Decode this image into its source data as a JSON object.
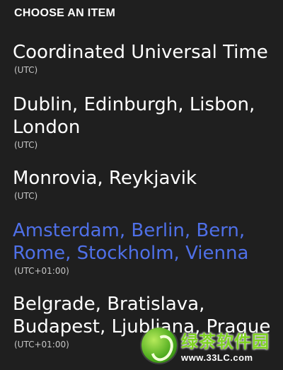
{
  "header": {
    "title": "CHOOSE AN ITEM"
  },
  "items": [
    {
      "name": "Coordinated Universal Time",
      "offset": "(UTC)"
    },
    {
      "name": "Dublin, Edinburgh, Lisbon, London",
      "line1": "Dublin, Edinburgh, Lisbon,",
      "line2": "London",
      "offset": "(UTC)"
    },
    {
      "name": "Monrovia, Reykjavik",
      "offset": "(UTC)"
    },
    {
      "name": "Amsterdam, Berlin, Bern, Rome, Stockholm, Vienna",
      "line1": "Amsterdam, Berlin, Bern,",
      "line2": "Rome, Stockholm, Vienna",
      "offset": "(UTC+01:00)",
      "selected": true
    },
    {
      "name": "Belgrade, Bratislava, Budapest, Ljubljana, Prague",
      "line1": "Belgrade, Bratislava,",
      "line2": "Budapest, Ljubljana, Prague",
      "offset": "(UTC+01:00)"
    }
  ],
  "colors": {
    "background": "#1f1f1f",
    "accent": "#4f70e8",
    "secondary_text": "#c8c8c8"
  },
  "watermark": {
    "text_cn": "绿茶软件园",
    "url": "www.33LC.com"
  }
}
